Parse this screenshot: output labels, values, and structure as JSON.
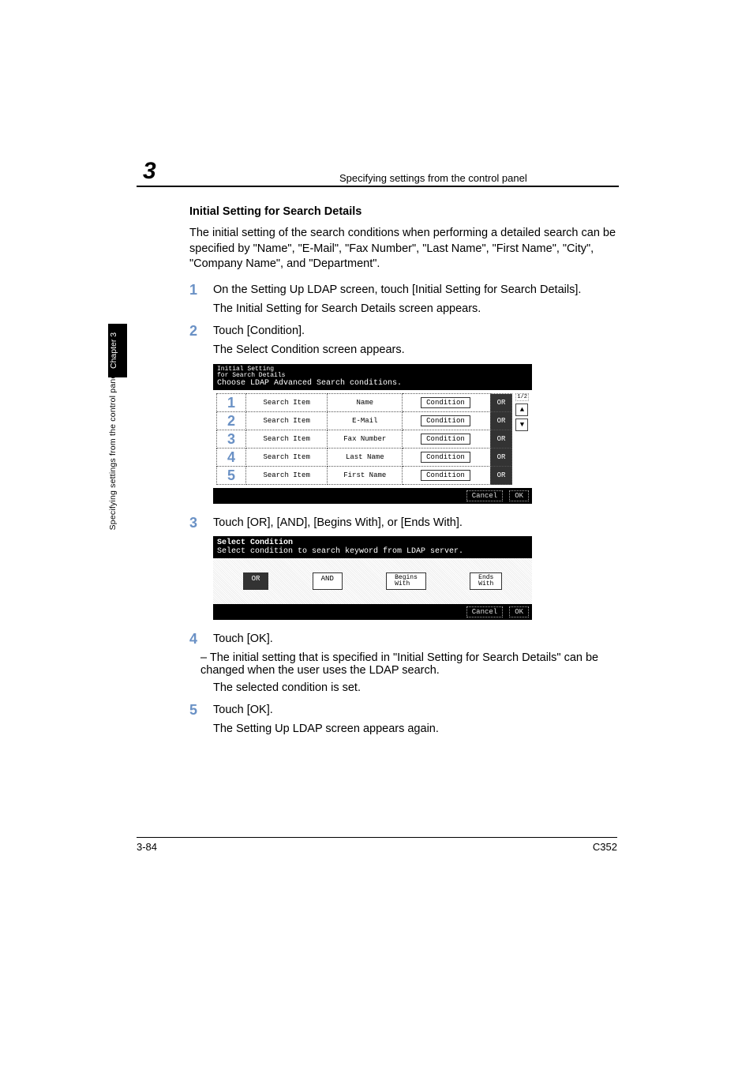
{
  "header": {
    "chapter_number": "3",
    "running_head": "Specifying settings from the control panel"
  },
  "sidebar": {
    "tab": "Chapter 3",
    "label": "Specifying settings from the control panel"
  },
  "section": {
    "title": "Initial Setting for Search Details",
    "intro": "The initial setting of the search conditions when performing a detailed search can be specified by \"Name\", \"E-Mail\", \"Fax Number\", \"Last Name\", \"First Name\", \"City\", \"Company Name\", and \"Department\"."
  },
  "steps": [
    {
      "n": "1",
      "text": "On the Setting Up LDAP screen, touch [Initial Setting for Search Details].",
      "after": "The Initial Setting for Search Details screen appears."
    },
    {
      "n": "2",
      "text": "Touch [Condition].",
      "after": "The Select Condition screen appears."
    },
    {
      "n": "3",
      "text": "Touch [OR], [AND], [Begins With], or [Ends With]."
    },
    {
      "n": "4",
      "text": "Touch [OK].",
      "dash": "The initial setting that is specified in \"Initial Setting for Search Details\" can be changed when the user uses the LDAP search.",
      "after": "The selected condition is set."
    },
    {
      "n": "5",
      "text": "Touch [OK].",
      "after": "The Setting Up LDAP screen appears again."
    }
  ],
  "panel1": {
    "title_small": "Initial Setting\nfor Search Details",
    "msg": "Choose LDAP Advanced Search conditions.",
    "col_item": "Search Item",
    "rows": [
      {
        "n": "1",
        "item": "Name",
        "cond": "OR"
      },
      {
        "n": "2",
        "item": "E-Mail",
        "cond": "OR"
      },
      {
        "n": "3",
        "item": "Fax Number",
        "cond": "OR"
      },
      {
        "n": "4",
        "item": "Last Name",
        "cond": "OR"
      },
      {
        "n": "5",
        "item": "First Name",
        "cond": "OR"
      }
    ],
    "cond_label": "Condition",
    "page": "1/2",
    "cancel": "Cancel",
    "ok": "OK"
  },
  "panel2": {
    "title": "Select Condition",
    "msg": "Select condition to search keyword from LDAP server.",
    "opts": [
      "OR",
      "AND",
      "Begins\nWith",
      "Ends\nWith"
    ],
    "cancel": "Cancel",
    "ok": "OK"
  },
  "footer": {
    "left": "3-84",
    "right": "C352"
  }
}
